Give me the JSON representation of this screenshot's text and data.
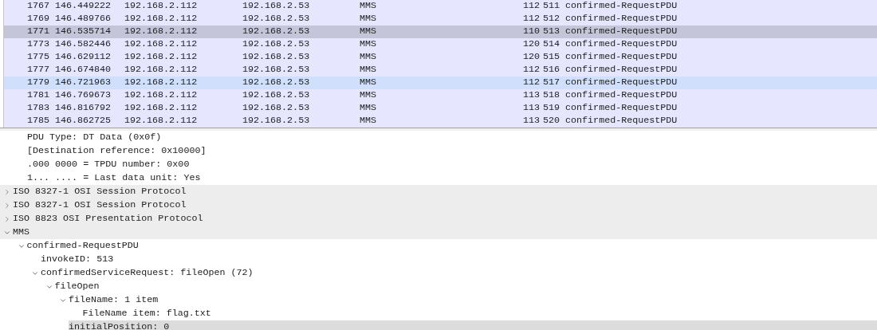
{
  "packet_list": {
    "rows": [
      {
        "no": "1767",
        "time": "146.449222",
        "source": "192.168.2.112",
        "destination": "192.168.2.53",
        "protocol": "MMS",
        "length": "112",
        "column_7": "511 confirmed-RequestPDU",
        "selected": false,
        "hovered": false
      },
      {
        "no": "1769",
        "time": "146.489766",
        "source": "192.168.2.112",
        "destination": "192.168.2.53",
        "protocol": "MMS",
        "length": "112",
        "column_7": "512 confirmed-RequestPDU",
        "selected": false,
        "hovered": false
      },
      {
        "no": "1771",
        "time": "146.535714",
        "source": "192.168.2.112",
        "destination": "192.168.2.53",
        "protocol": "MMS",
        "length": "110",
        "column_7": "513 confirmed-RequestPDU",
        "selected": true,
        "hovered": false
      },
      {
        "no": "1773",
        "time": "146.582446",
        "source": "192.168.2.112",
        "destination": "192.168.2.53",
        "protocol": "MMS",
        "length": "120",
        "column_7": "514 confirmed-RequestPDU",
        "selected": false,
        "hovered": false
      },
      {
        "no": "1775",
        "time": "146.629112",
        "source": "192.168.2.112",
        "destination": "192.168.2.53",
        "protocol": "MMS",
        "length": "120",
        "column_7": "515 confirmed-RequestPDU",
        "selected": false,
        "hovered": false
      },
      {
        "no": "1777",
        "time": "146.674840",
        "source": "192.168.2.112",
        "destination": "192.168.2.53",
        "protocol": "MMS",
        "length": "112",
        "column_7": "516 confirmed-RequestPDU",
        "selected": false,
        "hovered": false
      },
      {
        "no": "1779",
        "time": "146.721963",
        "source": "192.168.2.112",
        "destination": "192.168.2.53",
        "protocol": "MMS",
        "length": "112",
        "column_7": "517 confirmed-RequestPDU",
        "selected": false,
        "hovered": true
      },
      {
        "no": "1781",
        "time": "146.769673",
        "source": "192.168.2.112",
        "destination": "192.168.2.53",
        "protocol": "MMS",
        "length": "113",
        "column_7": "518 confirmed-RequestPDU",
        "selected": false,
        "hovered": false
      },
      {
        "no": "1783",
        "time": "146.816792",
        "source": "192.168.2.112",
        "destination": "192.168.2.53",
        "protocol": "MMS",
        "length": "113",
        "column_7": "519 confirmed-RequestPDU",
        "selected": false,
        "hovered": false
      },
      {
        "no": "1785",
        "time": "146.862725",
        "source": "192.168.2.112",
        "destination": "192.168.2.53",
        "protocol": "MMS",
        "length": "113",
        "column_7": "520 confirmed-RequestPDU",
        "selected": false,
        "hovered": false
      }
    ]
  },
  "packet_details": {
    "continued_children": [
      {
        "label": "PDU Type: DT Data (0x0f)"
      },
      {
        "label": "[Destination reference: 0x10000]"
      },
      {
        "label": ".000 0000 = TPDU number: 0x00"
      },
      {
        "label": "1... .... = Last data unit: Yes"
      }
    ],
    "items": [
      {
        "label": "ISO 8327-1 OSI Session Protocol",
        "expanded": false,
        "selected": false
      },
      {
        "label": "ISO 8327-1 OSI Session Protocol",
        "expanded": false,
        "selected": false
      },
      {
        "label": "ISO 8823 OSI Presentation Protocol",
        "expanded": false,
        "selected": false
      },
      {
        "label": "MMS",
        "expanded": true,
        "selected": false,
        "children": [
          {
            "label": "confirmed-RequestPDU",
            "expanded": true,
            "selected": false,
            "children": [
              {
                "label": "invokeID: 513",
                "selected": false
              },
              {
                "label": "confirmedServiceRequest: fileOpen (72)",
                "expanded": true,
                "selected": false,
                "children": [
                  {
                    "label": "fileOpen",
                    "expanded": true,
                    "selected": false,
                    "children": [
                      {
                        "label": "fileName: 1 item",
                        "expanded": true,
                        "selected": false,
                        "children": [
                          {
                            "label": "FileName item: flag.txt",
                            "selected": false
                          }
                        ]
                      },
                      {
                        "label": "initialPosition: 0",
                        "selected": true
                      }
                    ]
                  }
                ]
              }
            ]
          }
        ]
      }
    ]
  }
}
